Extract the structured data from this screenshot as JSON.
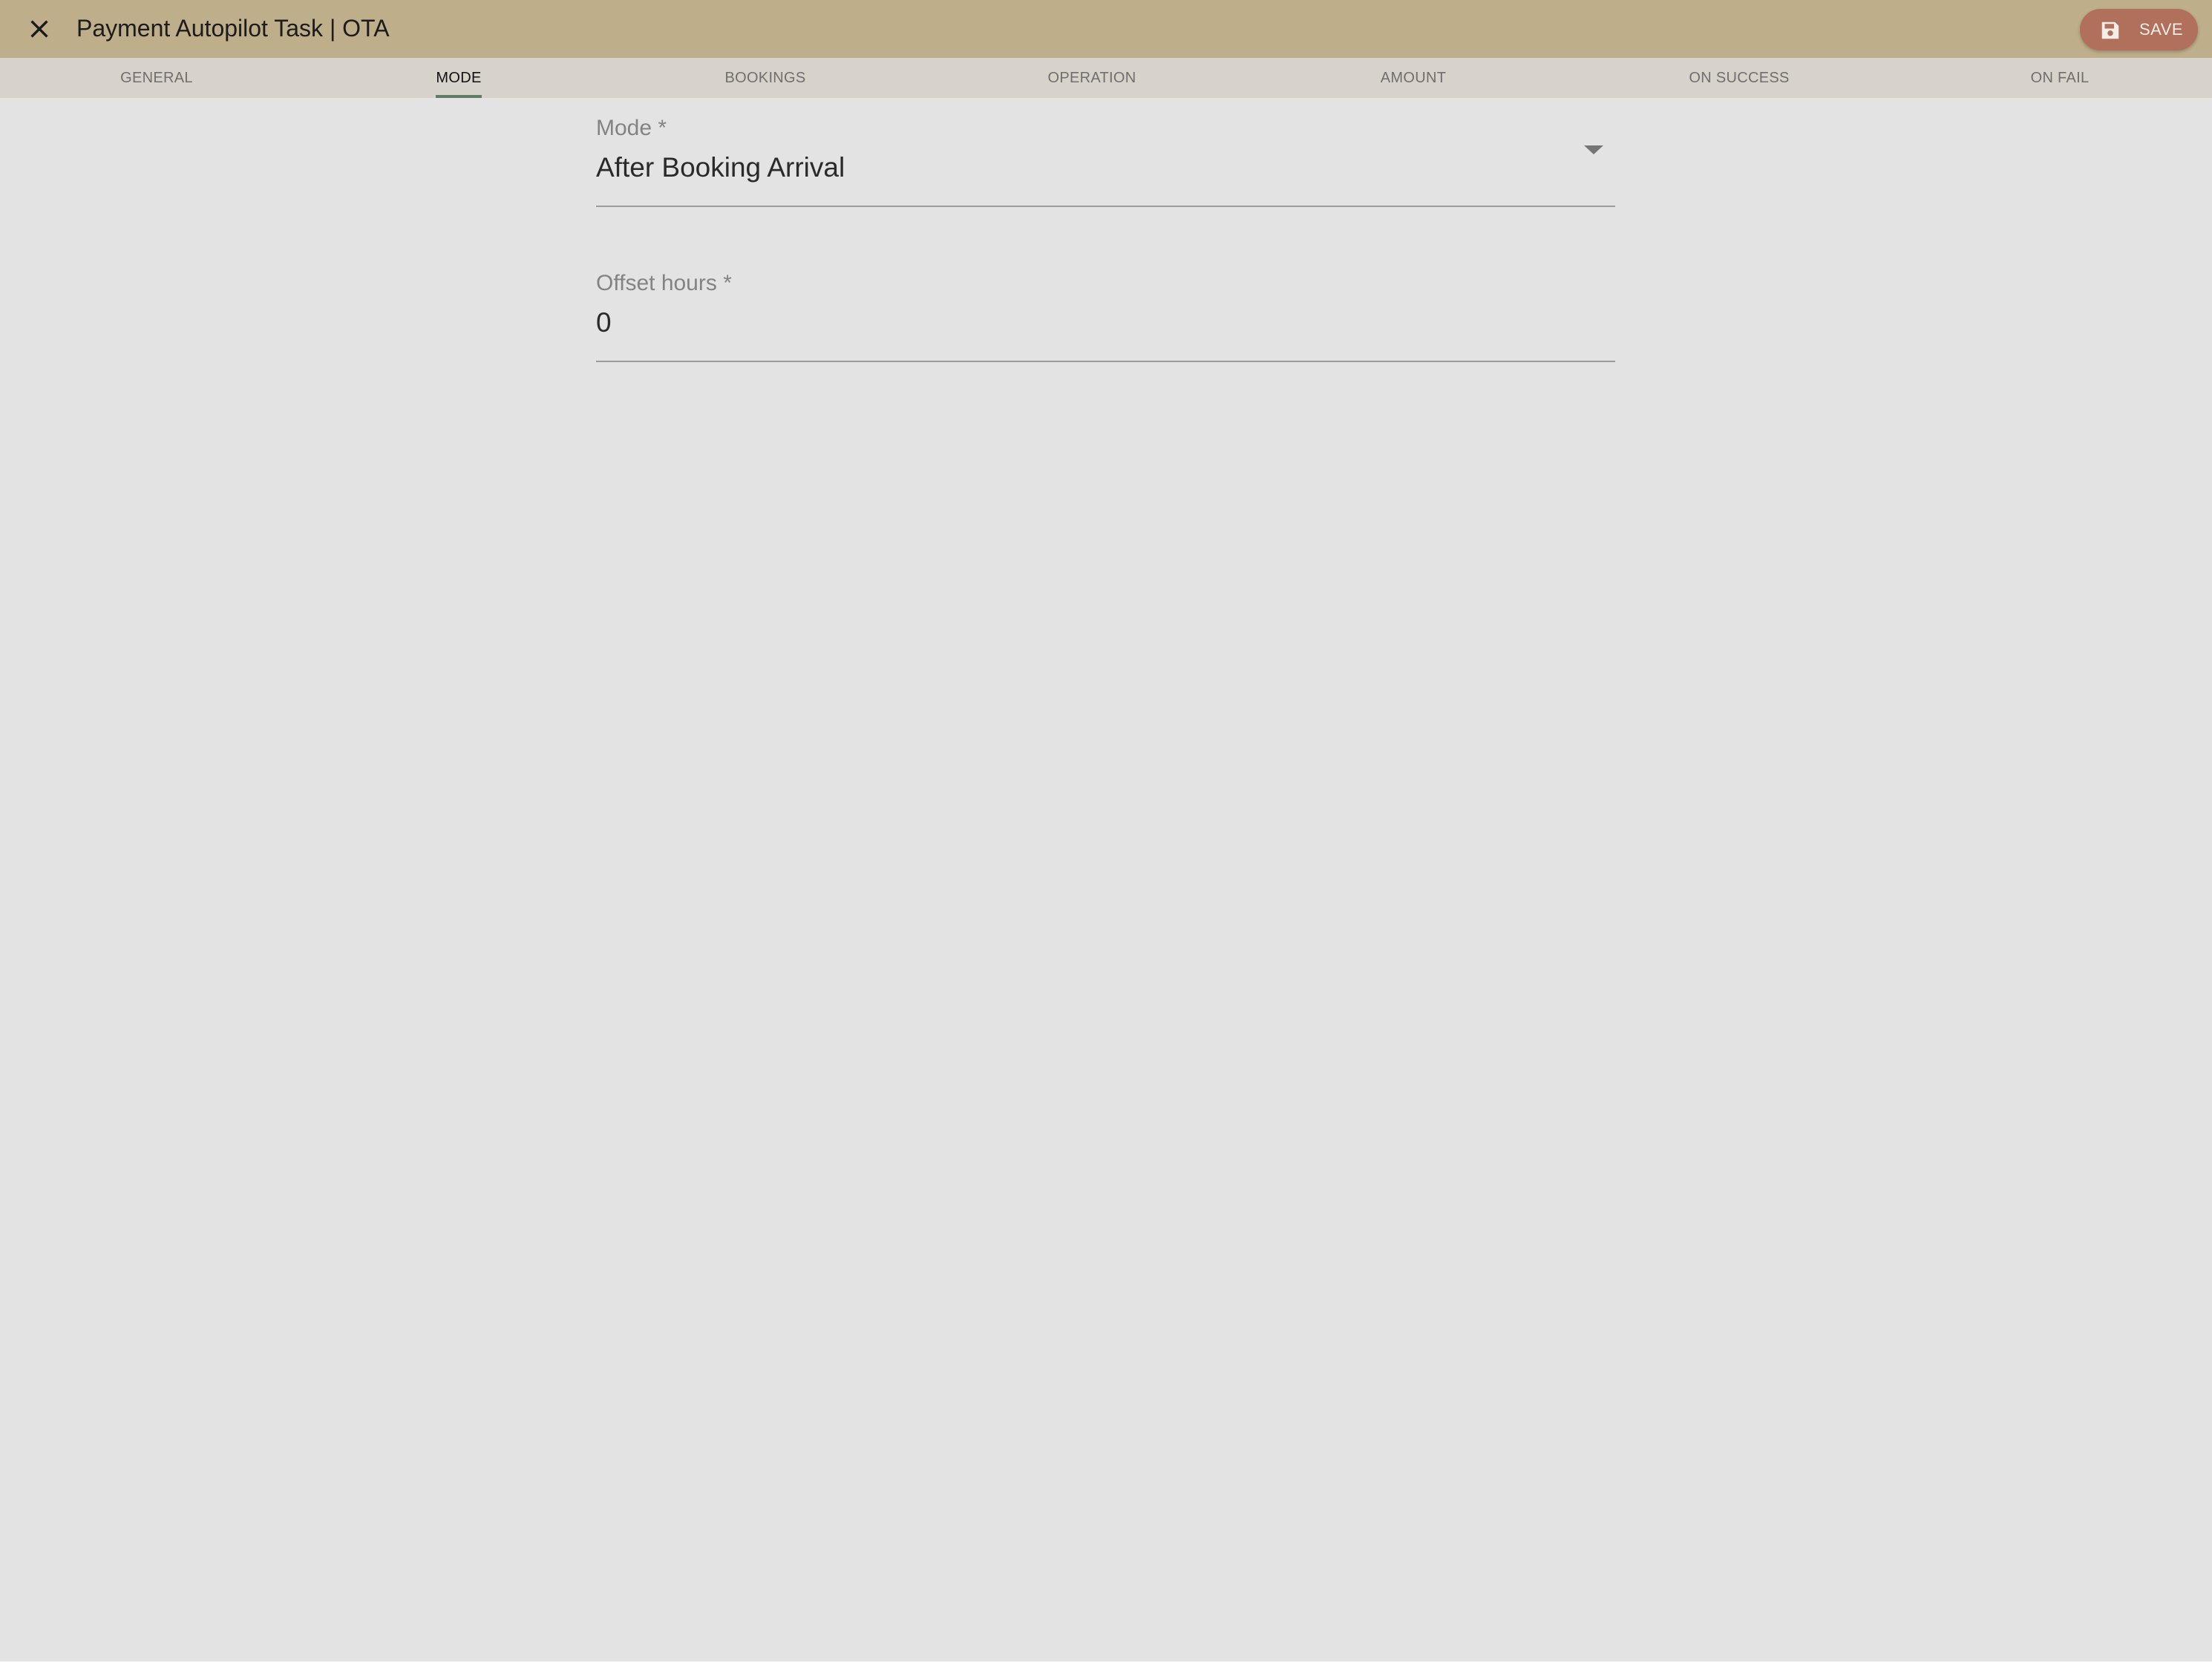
{
  "window": {
    "title": "Payment Autopilot Task | OTA"
  },
  "toolbar": {
    "close_icon": "close-icon",
    "save_icon": "floppy-disk-icon",
    "save_label": "SAVE",
    "colors": {
      "toolbar_bg": "#beae8a",
      "save_button_bg": "#b0705c"
    }
  },
  "tabs": {
    "active_index": 1,
    "indicator_color": "#5f7d63",
    "items": [
      {
        "label": "GENERAL"
      },
      {
        "label": "MODE"
      },
      {
        "label": "BOOKINGS"
      },
      {
        "label": "OPERATION"
      },
      {
        "label": "AMOUNT"
      },
      {
        "label": "ON SUCCESS"
      },
      {
        "label": "ON FAIL"
      }
    ]
  },
  "form": {
    "mode": {
      "label": "Mode *",
      "value": "After Booking Arrival",
      "icon": "dropdown-arrow-icon"
    },
    "offset_hours": {
      "label": "Offset hours *",
      "value": "0"
    }
  }
}
